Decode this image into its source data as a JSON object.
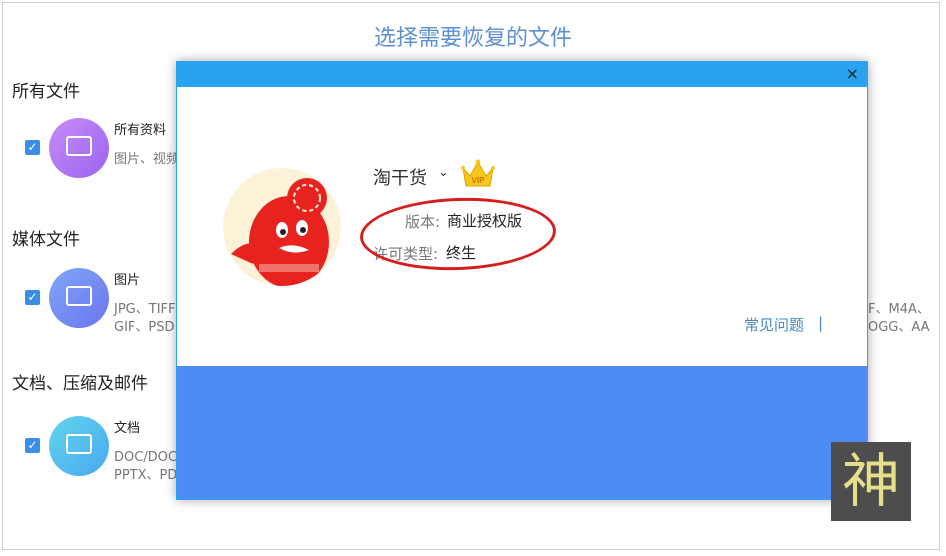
{
  "page_title": "选择需要恢复的文件",
  "sections": [
    {
      "title": "所有文件",
      "item_name": "所有资料",
      "item_desc": "图片、视频"
    },
    {
      "title": "媒体文件",
      "item_name": "图片",
      "item_desc": "JPG、TIFF\nGIF、PSD"
    },
    {
      "title": "文档、压缩及邮件",
      "item_name": "文档",
      "item_desc": "DOC/DOC\nPPTX、PD"
    }
  ],
  "right_fragments": {
    "media": "F、M4A、\nOGG、AA"
  },
  "dialog": {
    "close_glyph": "×",
    "username": "淘干货",
    "chevron": "⌄",
    "vip_label": "VIP",
    "version_label": "版本:",
    "version_value": "商业授权版",
    "license_label": "许可类型:",
    "license_value": "终生",
    "faq_link": "常见问题",
    "faq_separator": "|"
  },
  "watermark": "神",
  "colors": {
    "accent": "#29a3ef",
    "footer": "#4d8cf5",
    "highlight": "#d51f1f",
    "title": "#5b8fd6"
  }
}
